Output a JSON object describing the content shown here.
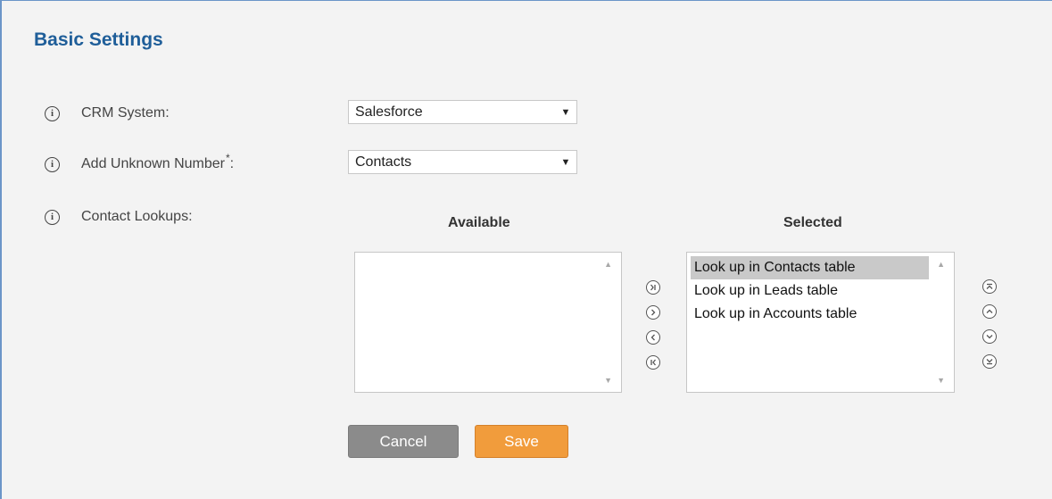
{
  "panel": {
    "title": "Basic Settings"
  },
  "fields": {
    "crm_system": {
      "label": "CRM System:",
      "value": "Salesforce"
    },
    "add_unknown": {
      "label": "Add Unknown Number",
      "required_mark": "*",
      "suffix": ":",
      "value": "Contacts"
    },
    "contact_lookups": {
      "label": "Contact Lookups:"
    }
  },
  "lookups": {
    "available_header": "Available",
    "selected_header": "Selected",
    "available_items": [],
    "selected_items": [
      "Look up in Contacts table",
      "Look up in Leads table",
      "Look up in Accounts table"
    ]
  },
  "actions": {
    "cancel_label": "Cancel",
    "save_label": "Save"
  },
  "colors": {
    "title": "#1f5e99",
    "save": "#f19c3c",
    "cancel": "#8b8b8b",
    "frame_border": "#6b95c8"
  }
}
